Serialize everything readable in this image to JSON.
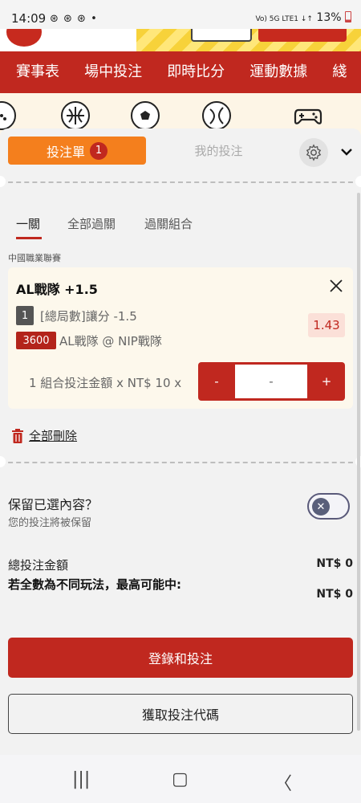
{
  "status_bar": {
    "time": "14:09",
    "notif_icons": "⊛ ⊛ ⊛ •",
    "signal_text": "Vo) 5G LTE1 ↓↑",
    "battery": "13%"
  },
  "nav": {
    "items": [
      "賽事表",
      "場中投注",
      "即時比分",
      "運動數據",
      "綫"
    ]
  },
  "sports": {
    "icons": [
      "dice-icon",
      "basketball-icon",
      "soccer-icon",
      "tennis-icon",
      "gamepad-icon"
    ]
  },
  "slip": {
    "tab_betslip": "投注單",
    "tab_betslip_count": "1",
    "tab_my_bets": "我的投注",
    "subtabs": [
      "一關",
      "全部過關",
      "過關組合"
    ],
    "league": "中國職業聯賽",
    "selection": {
      "title": "AL戰隊 +1.5",
      "number": "1",
      "market": "[總局數]讓分 -1.5",
      "odds": "1.43",
      "event_id": "3600",
      "match": "AL戰隊 @ NIP戰隊",
      "stake_label": "1 組合投注金額 x NT$ 10 x",
      "stepper_minus": "-",
      "stepper_value": "-",
      "stepper_plus": "+"
    },
    "delete_all": "全部刪除",
    "keep": {
      "title": "保留已選內容？",
      "subtitle": "您的投注將被保留"
    },
    "total_label": "總投注金額",
    "total_value": "NT$ 0",
    "max_win_label": "若全數為不同玩法，最高可能中:",
    "max_win_value": "NT$ 0",
    "login_button": "登錄和投注",
    "code_button": "獲取投注代碼"
  },
  "android_nav": {
    "recent": "|||",
    "home": "▢",
    "back": "〈"
  },
  "colors": {
    "brand_red": "#c0281f",
    "orange": "#f47f1d"
  }
}
